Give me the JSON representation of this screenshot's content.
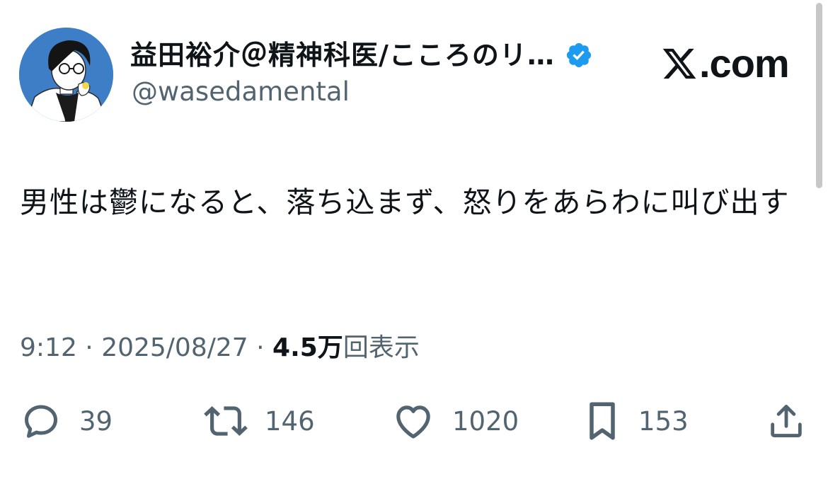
{
  "author": {
    "display_name": "益田裕介＠精神科医/こころのリ…",
    "handle": "@wasedamental",
    "verified": true
  },
  "brand": {
    "logo": "x-logo-icon",
    "domain": ".com"
  },
  "tweet": {
    "text": "男性は鬱になると、落ち込まず、怒りをあらわに叫び出す",
    "time": "9:12",
    "separator": " · ",
    "date": "2025/08/27",
    "views_count": "4.5万",
    "views_label": "回表示"
  },
  "actions": {
    "reply": {
      "icon": "reply-icon",
      "count": "39"
    },
    "retweet": {
      "icon": "retweet-icon",
      "count": "146"
    },
    "like": {
      "icon": "heart-icon",
      "count": "1020"
    },
    "bookmark": {
      "icon": "bookmark-icon",
      "count": "153"
    },
    "share": {
      "icon": "share-icon"
    }
  },
  "colors": {
    "text": "#0f1419",
    "secondary": "#536471",
    "verified": "#1d9bf0",
    "avatar_bg": "#3d7ec7"
  }
}
